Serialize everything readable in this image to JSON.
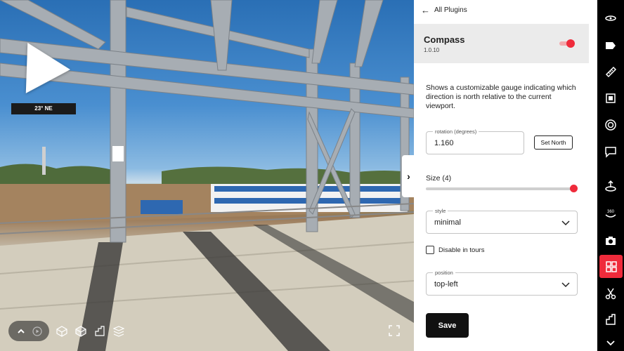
{
  "viewport": {
    "compass_readout": "23° NE",
    "toolbar_icons": [
      "chevron-up-icon",
      "play-icon",
      "wireframe-cube-icon",
      "solid-cube-icon",
      "floorplan-icon",
      "layers-icon"
    ],
    "fullscreen_icon": "fullscreen-icon",
    "collapse_glyph": "›"
  },
  "panel": {
    "back_label": "All Plugins",
    "plugin": {
      "name": "Compass",
      "version": "1.0.10",
      "enabled": true
    },
    "description": "Shows a customizable gauge indicating which direction is north relative to the current viewport.",
    "rotation": {
      "label": "rotation (degrees)",
      "value": "1.160"
    },
    "set_north_label": "Set North",
    "size": {
      "label": "Size (4)",
      "value": 4,
      "fraction": 1.0
    },
    "style": {
      "label": "style",
      "value": "minimal"
    },
    "disable_in_tours": {
      "label": "Disable in tours",
      "checked": false
    },
    "position": {
      "label": "position",
      "value": "top-left"
    },
    "save_label": "Save"
  },
  "rail": {
    "items": [
      "navigation-icon",
      "tag-icon",
      "measure-icon",
      "film-icon",
      "target-icon",
      "comment-icon",
      "floor-height-icon",
      "360-view-icon",
      "camera-icon",
      "plugins-icon",
      "scissors-icon",
      "floorplan-icon",
      "chevron-down-icon"
    ],
    "rail_360_text": "360",
    "active": "plugins-icon"
  },
  "colors": {
    "accent": "#ef2b3b",
    "panel_header": "#ebebeb",
    "rail": "#000000"
  }
}
